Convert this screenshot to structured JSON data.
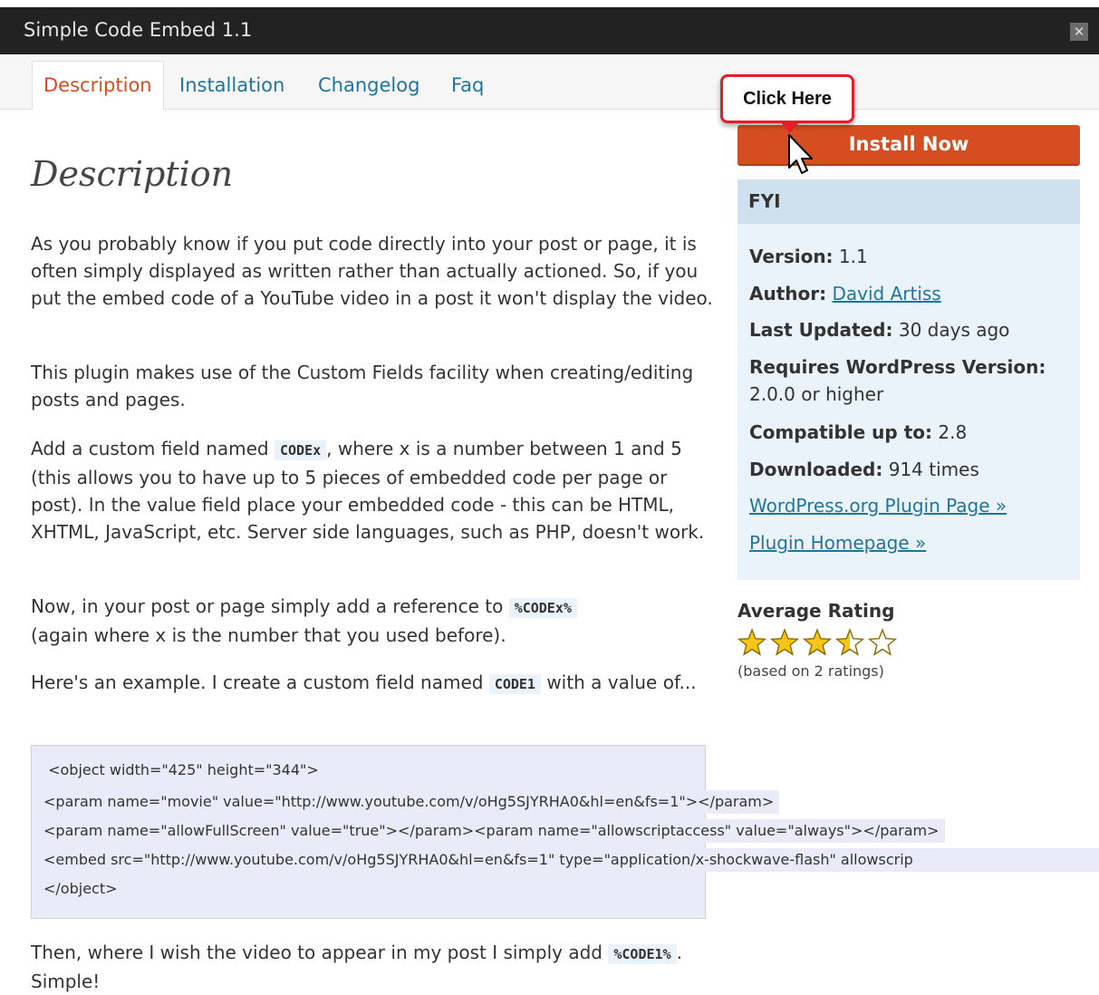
{
  "window": {
    "title": "Simple Code Embed 1.1",
    "close_label": "✕"
  },
  "tabs": [
    {
      "label": "Description",
      "active": true
    },
    {
      "label": "Installation",
      "active": false
    },
    {
      "label": "Changelog",
      "active": false
    },
    {
      "label": "Faq",
      "active": false
    }
  ],
  "main": {
    "heading": "Description",
    "p1": "As you probably know if you put code directly into your post or page, it is often simply displayed as written rather than actually actioned. So, if you put the embed code of a YouTube video in a post it won't display the video.",
    "p2": "This plugin makes use of the Custom Fields facility when creating/editing posts and pages.",
    "p3a": "Add a custom field named ",
    "p3code": "CODEx",
    "p3b": ", where x is a number between 1 and 5 (this allows you to have up to 5 pieces of embedded code per page or post). In the value field place your embedded code - this can be HTML, XHTML, JavaScript, etc. Server side languages, such as PHP, doesn't work.",
    "p4a": "Now, in your post or page simply add a reference to ",
    "p4code": "%CODEx%",
    "p4b": "(again where x is the number that you used before).",
    "p5a": "Here's an example. I create a custom field named ",
    "p5code": "CODE1",
    "p5b": " with a value of...",
    "code_lines": [
      " <object width=\"425\" height=\"344\">",
      "<param name=\"movie\" value=\"http://www.youtube.com/v/oHg5SJYRHA0&hl=en&fs=1\"></param>",
      "<param name=\"allowFullScreen\" value=\"true\"></param><param name=\"allowscriptaccess\" value=\"always\"></param>",
      "<embed src=\"http://www.youtube.com/v/oHg5SJYRHA0&hl=en&fs=1\" type=\"application/x-shockwave-flash\" allowscrip",
      "</object>"
    ],
    "p6a": "Then, where I wish the video to appear in my post I simply add ",
    "p6code": "%CODE1%",
    "p6b": ". Simple!"
  },
  "sidebar": {
    "callout": "Click Here",
    "install_label": "Install Now",
    "fyi_title": "FYI",
    "version_label": "Version:",
    "version_value": "1.1",
    "author_label": "Author:",
    "author_value": "David Artiss",
    "updated_label": "Last Updated:",
    "updated_value": "30 days ago",
    "requires_label": "Requires WordPress Version:",
    "requires_value": "2.0.0 or higher",
    "compatible_label": "Compatible up to:",
    "compatible_value": "2.8",
    "downloaded_label": "Downloaded:",
    "downloaded_value": "914 times",
    "link_plugin_page": "WordPress.org Plugin Page »",
    "link_homepage": "Plugin Homepage »",
    "rating_label": "Average Rating",
    "rating_value": 3.5,
    "rating_max": 5,
    "rating_count": "(based on 2 ratings)"
  },
  "colors": {
    "accent": "#d54e21",
    "link": "#21759b",
    "titlebar": "#222222"
  }
}
